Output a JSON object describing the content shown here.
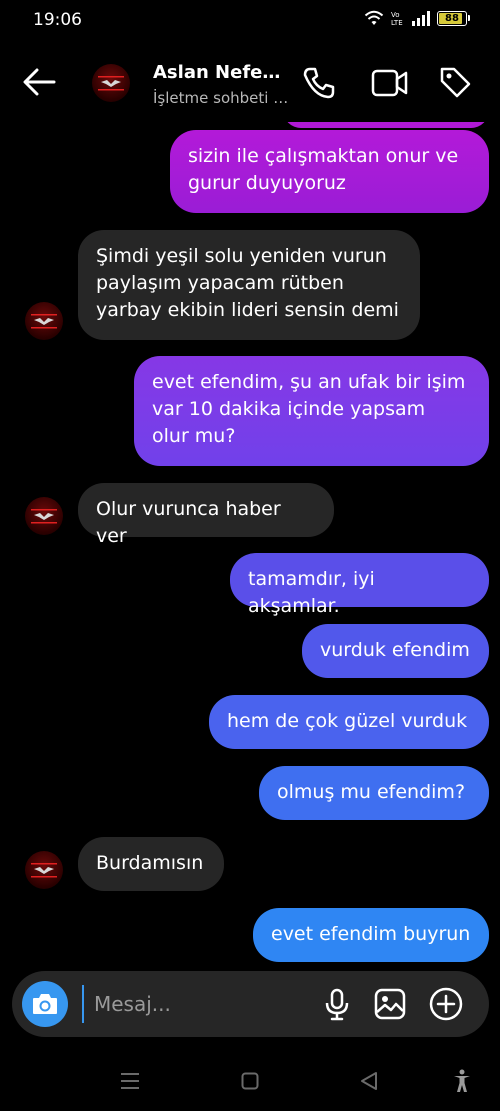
{
  "status_bar": {
    "time": "19:06",
    "battery": "88",
    "volte_label": "Vo LTE"
  },
  "header": {
    "title": "Aslan Nefe…",
    "subtitle": "İşletme sohbeti …"
  },
  "messages": [
    {
      "from": "me",
      "text": "sizin ile çalışmaktan onur ve\ngurur duyuyoruz",
      "color": "#a41ad6"
    },
    {
      "from": "them",
      "text": "Şimdi yeşil solu yeniden vurun\npaylaşım yapacam rütben\nyarbay ekibin lideri sensin demi"
    },
    {
      "from": "me",
      "text": "evet efendim, şu an ufak bir işim\nvar 10 dakika içinde yapsam\nolur mu?",
      "color": "#7d3ae8"
    },
    {
      "from": "them",
      "text": "Olur vurunca haber ver"
    },
    {
      "from": "me",
      "text": "tamamdır, iyi akşamlar.",
      "color": "#5a4fe9"
    },
    {
      "from": "me",
      "text": "vurduk efendim",
      "color": "#5158eb"
    },
    {
      "from": "me",
      "text": "hem de çok güzel vurduk",
      "color": "#4a63ee"
    },
    {
      "from": "me",
      "text": "olmuş mu efendim?",
      "color": "#3f6ff0"
    },
    {
      "from": "them",
      "text": "Burdamısın"
    },
    {
      "from": "me",
      "text": "evet efendim buyrun",
      "color": "#2f86f3"
    }
  ],
  "composer": {
    "placeholder": "Mesaj..."
  },
  "colors": {
    "accent": "#3797f0",
    "incoming_bubble": "#262626",
    "background": "#000000"
  },
  "icons": [
    "back-arrow-icon",
    "phone-icon",
    "video-camera-icon",
    "tag-icon",
    "camera-icon",
    "microphone-icon",
    "gallery-icon",
    "plus-circle-icon"
  ]
}
